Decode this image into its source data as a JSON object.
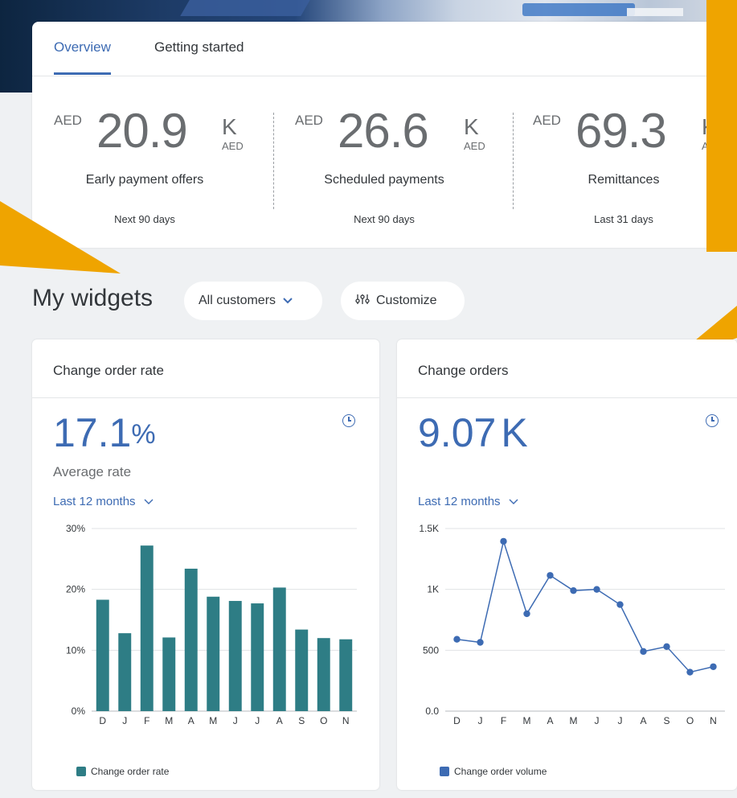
{
  "tabs": [
    "Overview",
    "Getting started"
  ],
  "kpis": [
    {
      "prefix": "AED",
      "value": "20.9",
      "scale": "K",
      "unit": "AED",
      "label": "Early payment offers",
      "period": "Next 90 days"
    },
    {
      "prefix": "AED",
      "value": "26.6",
      "scale": "K",
      "unit": "AED",
      "label": "Scheduled payments",
      "period": "Next 90 days"
    },
    {
      "prefix": "AED",
      "value": "69.3",
      "scale": "K",
      "unit": "A",
      "label": "Remittances",
      "period": "Last 31 days"
    }
  ],
  "widgets_header": {
    "title": "My widgets",
    "filter_label": "All customers",
    "customize_label": "Customize"
  },
  "widgets": [
    {
      "title": "Change order rate",
      "value": "17.1",
      "unit": "%",
      "subtitle": "Average rate",
      "range": "Last 12 months",
      "legend": "Change order rate"
    },
    {
      "title": "Change orders",
      "value": "9.07",
      "unit": "K",
      "subtitle": "",
      "range": "Last 12 months",
      "legend": "Change order volume"
    }
  ],
  "colors": {
    "accent": "#3d6bb3",
    "bar": "#2e7d85",
    "callout": "#efa400"
  },
  "chart_data": [
    {
      "type": "bar",
      "categories": [
        "D",
        "J",
        "F",
        "M",
        "A",
        "M",
        "J",
        "J",
        "A",
        "S",
        "O",
        "N"
      ],
      "values": [
        18.3,
        12.8,
        27.2,
        12.1,
        23.4,
        18.8,
        18.1,
        17.7,
        20.3,
        13.4,
        12.0,
        11.8
      ],
      "yticks": [
        "0%",
        "10%",
        "20%",
        "30%"
      ],
      "ylim": [
        0,
        30
      ],
      "series": [
        {
          "name": "Change order rate",
          "values": [
            18.3,
            12.8,
            27.2,
            12.1,
            23.4,
            18.8,
            18.1,
            17.7,
            20.3,
            13.4,
            12.0,
            11.8
          ]
        }
      ],
      "grid": true,
      "legend": "bottom-left"
    },
    {
      "type": "line",
      "categories": [
        "D",
        "J",
        "F",
        "M",
        "A",
        "M",
        "J",
        "J",
        "A",
        "S",
        "O",
        "N"
      ],
      "values": [
        590,
        565,
        1395,
        800,
        1115,
        990,
        1000,
        875,
        490,
        530,
        320,
        365
      ],
      "yticks": [
        "0.0",
        "500",
        "1K",
        "1.5K"
      ],
      "ylim": [
        0,
        1500
      ],
      "series": [
        {
          "name": "Change order volume",
          "values": [
            590,
            565,
            1395,
            800,
            1115,
            990,
            1000,
            875,
            490,
            530,
            320,
            365
          ]
        }
      ],
      "grid": true,
      "legend": "bottom-left"
    }
  ]
}
